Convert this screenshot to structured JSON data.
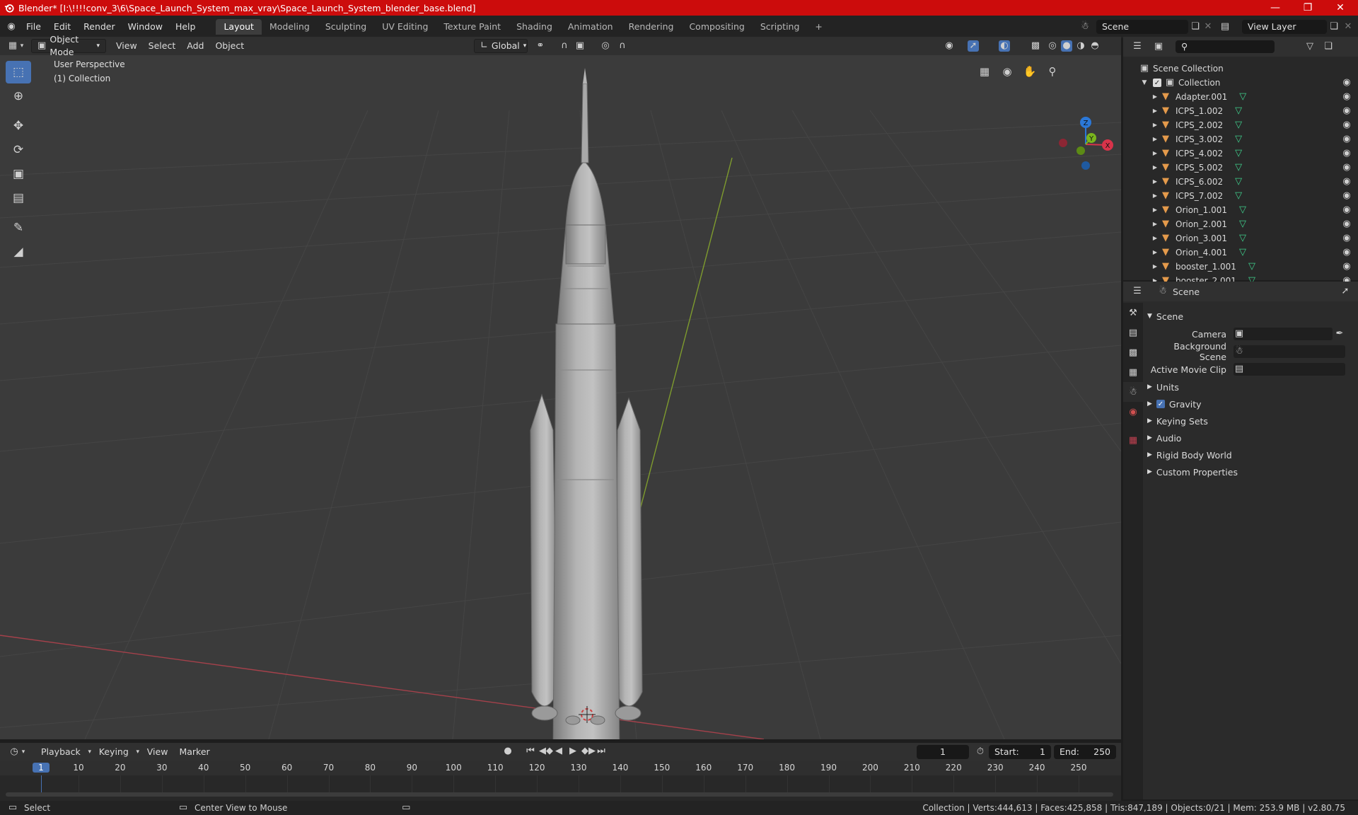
{
  "window": {
    "title": "Blender* [I:\\!!!!conv_3\\6\\Space_Launch_System_max_vray\\Space_Launch_System_blender_base.blend]",
    "controls": [
      "minimize",
      "maximize",
      "close"
    ]
  },
  "menu": [
    "File",
    "Edit",
    "Render",
    "Window",
    "Help"
  ],
  "workspaces": [
    "Layout",
    "Modeling",
    "Sculpting",
    "UV Editing",
    "Texture Paint",
    "Shading",
    "Animation",
    "Rendering",
    "Compositing",
    "Scripting"
  ],
  "active_workspace": "Layout",
  "scene_field": "Scene",
  "view_layer_field": "View Layer",
  "viewport_header": {
    "mode": "Object Mode",
    "menus": [
      "View",
      "Select",
      "Add",
      "Object"
    ],
    "transform_orientation": "Global"
  },
  "viewport": {
    "perspective_label": "User Perspective",
    "collection_label": "(1) Collection",
    "gizmo_axes": [
      "Z",
      "Y",
      "X"
    ]
  },
  "outliner": {
    "root": "Scene Collection",
    "collection": "Collection",
    "items": [
      "Adapter.001",
      "ICPS_1.002",
      "ICPS_2.002",
      "ICPS_3.002",
      "ICPS_4.002",
      "ICPS_5.002",
      "ICPS_6.002",
      "ICPS_7.002",
      "Orion_1.001",
      "Orion_2.001",
      "Orion_3.001",
      "Orion_4.001",
      "booster_1.001",
      "booster_2.001"
    ]
  },
  "properties": {
    "context": "Scene",
    "panel_title": "Scene",
    "fields": [
      {
        "label": "Camera",
        "value": ""
      },
      {
        "label": "Background Scene",
        "value": ""
      },
      {
        "label": "Active Movie Clip",
        "value": ""
      }
    ],
    "subpanels": [
      "Units",
      "Gravity",
      "Keying Sets",
      "Audio",
      "Rigid Body World",
      "Custom Properties"
    ],
    "gravity_checked": true
  },
  "timeline": {
    "menus": [
      "Playback",
      "Keying",
      "View",
      "Marker"
    ],
    "current_frame": "1",
    "start_label": "Start:",
    "start": "1",
    "end_label": "End:",
    "end": "250",
    "ticks": [
      "1",
      "10",
      "20",
      "30",
      "40",
      "50",
      "60",
      "70",
      "80",
      "90",
      "100",
      "110",
      "120",
      "130",
      "140",
      "150",
      "160",
      "170",
      "180",
      "190",
      "200",
      "210",
      "220",
      "230",
      "240",
      "250"
    ]
  },
  "statusbar": {
    "left": "Select",
    "middle": "Center View to Mouse",
    "right": "Collection | Verts:444,613 | Faces:425,858 | Tris:847,189 | Objects:0/21 | Mem: 253.9 MB | v2.80.75"
  },
  "colors": {
    "titlebar": "#cc0c0c",
    "accent": "#4772b3",
    "mesh_icon": "#e49a4b",
    "data_icon": "#3fcf8c"
  }
}
